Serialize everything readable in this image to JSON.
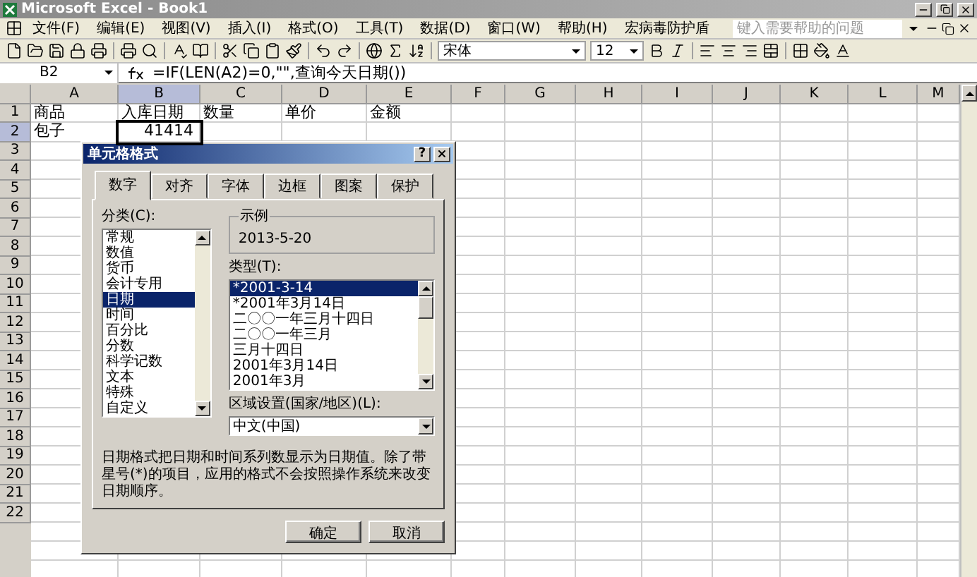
{
  "window": {
    "title": "Microsoft Excel - Book1"
  },
  "menu": [
    {
      "label": "文件(F)"
    },
    {
      "label": "编辑(E)"
    },
    {
      "label": "视图(V)"
    },
    {
      "label": "插入(I)"
    },
    {
      "label": "格式(O)"
    },
    {
      "label": "工具(T)"
    },
    {
      "label": "数据(D)"
    },
    {
      "label": "窗口(W)"
    },
    {
      "label": "帮助(H)"
    },
    {
      "label": "宏病毒防护盾"
    }
  ],
  "help_search": {
    "placeholder": "键入需要帮助的问题"
  },
  "format_toolbar": {
    "font": "宋体",
    "size": "12"
  },
  "formula_bar": {
    "name_box": "B2",
    "formula": "=IF(LEN(A2)=0,\"\",查询今天日期())"
  },
  "sheet": {
    "columns": [
      {
        "label": "A",
        "selected": false
      },
      {
        "label": "B",
        "selected": true
      },
      {
        "label": "C",
        "selected": false
      },
      {
        "label": "D",
        "selected": false
      },
      {
        "label": "E",
        "selected": false
      },
      {
        "label": "F",
        "selected": false
      },
      {
        "label": "G",
        "selected": false
      },
      {
        "label": "H",
        "selected": false
      },
      {
        "label": "I",
        "selected": false
      },
      {
        "label": "J",
        "selected": false
      },
      {
        "label": "K",
        "selected": false
      },
      {
        "label": "L",
        "selected": false
      },
      {
        "label": "M",
        "selected": false
      }
    ],
    "rows": [
      {
        "label": "1",
        "selected": false,
        "cells": [
          {
            "text": "商品",
            "kind": "text",
            "selected": false
          },
          {
            "text": "入库日期",
            "kind": "text",
            "selected": false
          },
          {
            "text": "数量",
            "kind": "text",
            "selected": false
          },
          {
            "text": "单价",
            "kind": "text",
            "selected": false
          },
          {
            "text": "金额",
            "kind": "text",
            "selected": false
          }
        ]
      },
      {
        "label": "2",
        "selected": true,
        "cells": [
          {
            "text": "包子",
            "kind": "text",
            "selected": false
          },
          {
            "text": "41414",
            "kind": "number",
            "selected": true
          }
        ]
      },
      {
        "label": "3",
        "selected": false
      },
      {
        "label": "4",
        "selected": false
      },
      {
        "label": "5",
        "selected": false
      },
      {
        "label": "6",
        "selected": false
      },
      {
        "label": "7",
        "selected": false
      },
      {
        "label": "8",
        "selected": false
      },
      {
        "label": "9",
        "selected": false
      },
      {
        "label": "10",
        "selected": false
      },
      {
        "label": "11",
        "selected": false
      },
      {
        "label": "12",
        "selected": false
      },
      {
        "label": "13",
        "selected": false
      },
      {
        "label": "14",
        "selected": false
      },
      {
        "label": "15",
        "selected": false
      },
      {
        "label": "16",
        "selected": false
      },
      {
        "label": "17",
        "selected": false
      },
      {
        "label": "18",
        "selected": false
      },
      {
        "label": "19",
        "selected": false
      },
      {
        "label": "20",
        "selected": false
      },
      {
        "label": "21",
        "selected": false
      },
      {
        "label": "22",
        "selected": false
      }
    ]
  },
  "dialog": {
    "title": "单元格格式",
    "help_button": "?",
    "tabs": [
      {
        "label": "数字",
        "selected": true
      },
      {
        "label": "对齐",
        "selected": false
      },
      {
        "label": "字体",
        "selected": false
      },
      {
        "label": "边框",
        "selected": false
      },
      {
        "label": "图案",
        "selected": false
      },
      {
        "label": "保护",
        "selected": false
      }
    ],
    "category_label": "分类(C):",
    "categories": [
      {
        "label": "常规",
        "selected": false
      },
      {
        "label": "数值",
        "selected": false
      },
      {
        "label": "货币",
        "selected": false
      },
      {
        "label": "会计专用",
        "selected": false
      },
      {
        "label": "日期",
        "selected": true
      },
      {
        "label": "时间",
        "selected": false
      },
      {
        "label": "百分比",
        "selected": false
      },
      {
        "label": "分数",
        "selected": false
      },
      {
        "label": "科学记数",
        "selected": false
      },
      {
        "label": "文本",
        "selected": false
      },
      {
        "label": "特殊",
        "selected": false
      },
      {
        "label": "自定义",
        "selected": false
      }
    ],
    "sample_label": "示例",
    "sample_value": "2013-5-20",
    "type_label": "类型(T):",
    "types": [
      {
        "label": "*2001-3-14",
        "selected": true
      },
      {
        "label": "*2001年3月14日",
        "selected": false
      },
      {
        "label": "二〇〇一年三月十四日",
        "selected": false
      },
      {
        "label": "二〇〇一年三月",
        "selected": false
      },
      {
        "label": "三月十四日",
        "selected": false
      },
      {
        "label": "2001年3月14日",
        "selected": false
      },
      {
        "label": "2001年3月",
        "selected": false
      }
    ],
    "locale_label": "区域设置(国家/地区)(L):",
    "locale_value": "中文(中国)",
    "description": "日期格式把日期和时间系列数显示为日期值。除了带星号(*)的项目，应用的格式不会按照操作系统来改变日期顺序。",
    "buttons": [
      "确定",
      "取消"
    ]
  }
}
